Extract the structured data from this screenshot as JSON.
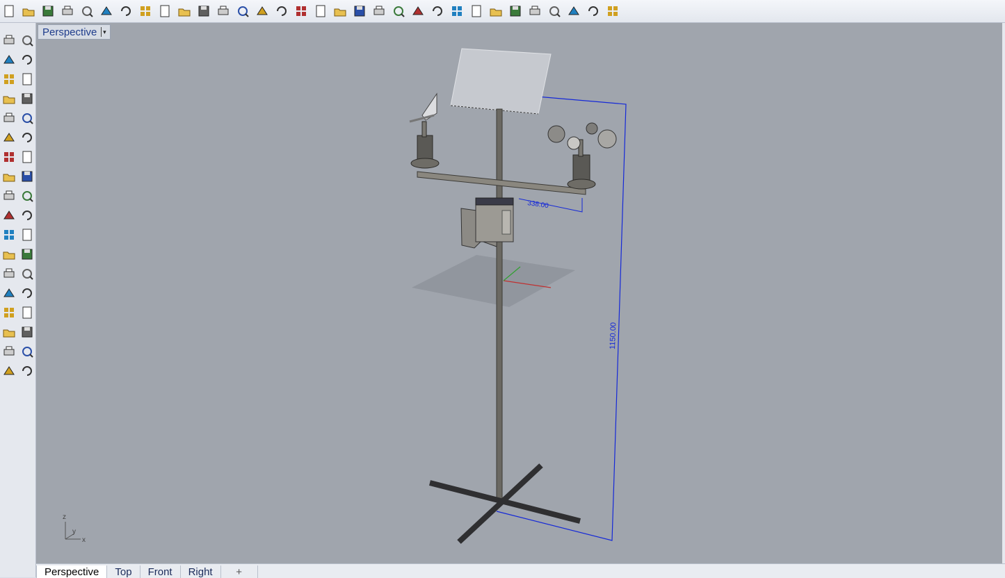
{
  "app": {
    "accent": "#1e3c8c",
    "viewport_bg": "#a0a5ad"
  },
  "toolbar": {
    "icons": [
      "new-file-icon",
      "open-folder-icon",
      "save-icon",
      "print-icon",
      "import-icon",
      "cut-icon",
      "copy-icon",
      "paste-icon",
      "undo-icon",
      "pan-hand-icon",
      "rotate-view-icon",
      "zoom-icon",
      "zoom-window-icon",
      "zoom-extents-icon",
      "zoom-selected-icon",
      "zoom-previous-icon",
      "four-viewports-icon",
      "car-render-icon",
      "layout-icon",
      "snap-icon",
      "points-icon",
      "light-bulb-icon",
      "lock-icon",
      "layers-icon",
      "color-wheel-icon",
      "shaded-sphere-icon",
      "rendered-sphere-icon",
      "render-sphere-icon",
      "filter-icon",
      "settings-gear-icon",
      "dimension-icon",
      "help-icon"
    ]
  },
  "sidebar": {
    "icons": [
      "select-arrow-icon",
      "point-icon",
      "line-icon",
      "polyline-icon",
      "circle-icon",
      "ellipse-icon",
      "arc-icon",
      "rectangle-icon",
      "polygon-icon",
      "curve-icon",
      "surface-icon",
      "extrude-surface-icon",
      "box-icon",
      "sphere-icon",
      "cylinder-icon",
      "mesh-icon",
      "explode-icon",
      "trim-icon",
      "split-icon",
      "dimension-tool-icon",
      "boolean-union-icon",
      "group-icon",
      "fillet-icon",
      "offset-icon",
      "project-icon",
      "scale-icon",
      "transform-icon",
      "edit-icon",
      "solid-box-icon",
      "array-icon",
      "grid-array-icon",
      "align-icon",
      "pen-icon",
      "check-icon",
      "surface-analysis-icon",
      "render-tool-icon"
    ]
  },
  "viewport": {
    "title": "Perspective",
    "dropdown_glyph": "▾",
    "dimension_width": "338.00",
    "dimension_height": "1150.00",
    "axis_z": "z",
    "axis_y": "y",
    "axis_x": "x"
  },
  "tabs": [
    {
      "label": "Perspective",
      "active": true
    },
    {
      "label": "Top"
    },
    {
      "label": "Front"
    },
    {
      "label": "Right"
    }
  ],
  "tab_add": "+"
}
